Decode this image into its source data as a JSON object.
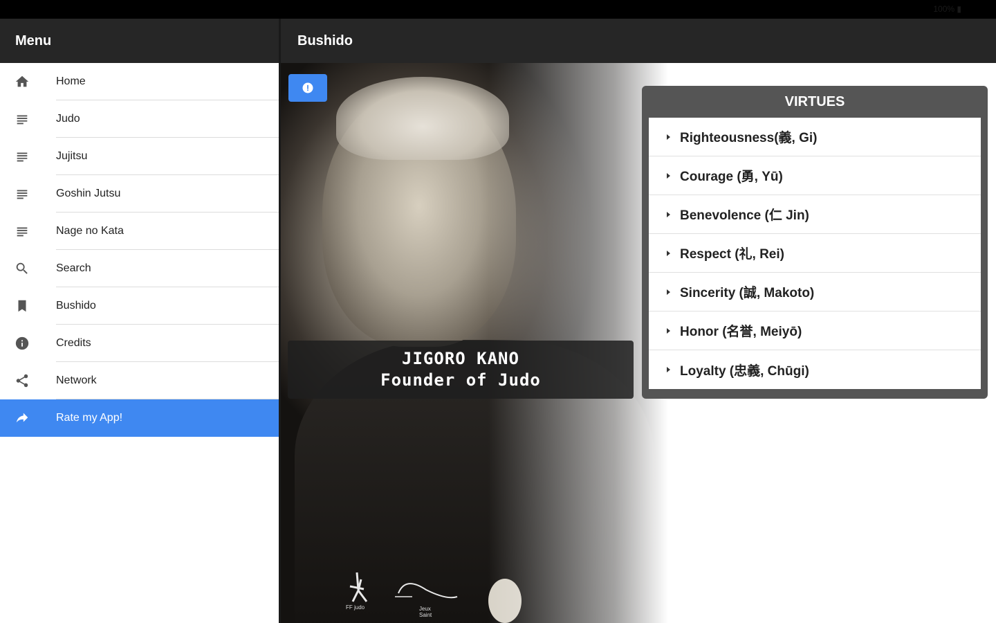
{
  "statusbar": {
    "text": "100% ▮"
  },
  "sidebar": {
    "title": "Menu",
    "items": [
      {
        "label": "Home",
        "icon": "home-icon"
      },
      {
        "label": "Judo",
        "icon": "list-icon"
      },
      {
        "label": "Jujitsu",
        "icon": "list-icon"
      },
      {
        "label": "Goshin Jutsu",
        "icon": "list-icon"
      },
      {
        "label": "Nage no Kata",
        "icon": "list-icon"
      },
      {
        "label": "Search",
        "icon": "search-icon"
      },
      {
        "label": "Bushido",
        "icon": "bookmark-icon"
      },
      {
        "label": "Credits",
        "icon": "info-icon"
      },
      {
        "label": "Network",
        "icon": "share-icon"
      },
      {
        "label": "Rate my App!",
        "icon": "forward-icon",
        "active": true
      }
    ]
  },
  "main": {
    "title": "Bushido",
    "caption": {
      "line1": "JIGORO KANO",
      "line2": "Founder of Judo"
    },
    "logos": {
      "left": "FF judo",
      "right": "Jeux Saint"
    }
  },
  "virtues": {
    "title": "VIRTUES",
    "items": [
      "Righteousness(義, Gi)",
      "Courage (勇, Yū)",
      "Benevolence (仁 Jin)",
      "Respect (礼, Rei)",
      "Sincerity (誠, Makoto)",
      "Honor (名誉, Meiyō)",
      "Loyalty (忠義, Chūgi)"
    ]
  },
  "colors": {
    "accent": "#3f88f1",
    "header": "#262626",
    "panel": "#555555"
  }
}
